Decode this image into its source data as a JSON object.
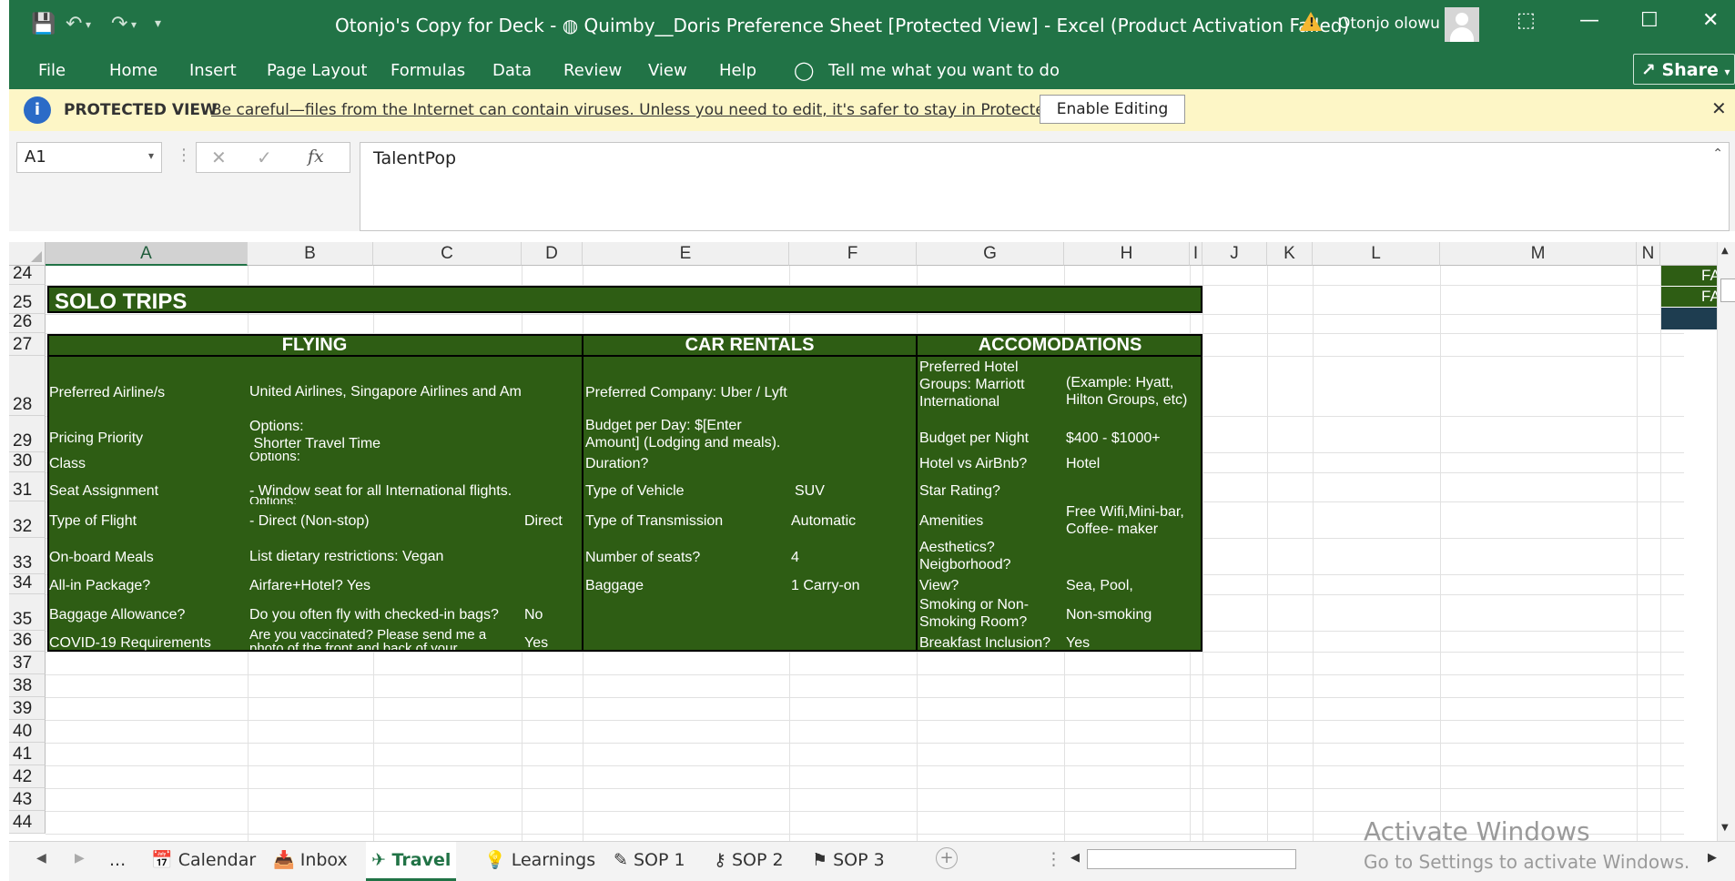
{
  "window": {
    "title": "Otonjo's Copy for Deck - ◍ Quimby__Doris Preference Sheet  [Protected View]  -  Excel (Product Activation Failed)",
    "user": "Otonjo olowu",
    "share_label": "Share"
  },
  "ribbon": {
    "tabs": [
      "File",
      "Home",
      "Insert",
      "Page Layout",
      "Formulas",
      "Data",
      "Review",
      "View",
      "Help"
    ],
    "tell_me": "Tell me what you want to do"
  },
  "protected_view": {
    "label": "PROTECTED VIEW",
    "message": "Be careful—files from the Internet can contain viruses. Unless you need to edit, it's safer to stay in Protected View.",
    "button": "Enable Editing"
  },
  "formula_bar": {
    "name_box": "A1",
    "fx": "fx",
    "formula": "TalentPop"
  },
  "columns": [
    "A",
    "B",
    "C",
    "D",
    "E",
    "F",
    "G",
    "H",
    "I",
    "J",
    "K",
    "L",
    "M",
    "N"
  ],
  "rows": [
    "24",
    "25",
    "26",
    "27",
    "28",
    "29",
    "30",
    "31",
    "32",
    "33",
    "34",
    "35",
    "36",
    "37",
    "38",
    "39",
    "40",
    "41",
    "42",
    "43",
    "44"
  ],
  "sheet": {
    "section_title": "SOLO TRIPS",
    "flying": {
      "header": "FLYING",
      "items": [
        {
          "label": "Preferred Airline/s",
          "value": "United Airlines, Singapore Airlines and Am",
          "extra": ""
        },
        {
          "label": "Pricing Priority",
          "value": "Options:\n Shorter Travel Time",
          "extra": ""
        },
        {
          "label": "Class",
          "value": "Options:",
          "extra": ""
        },
        {
          "label": "Seat Assignment",
          "value": "- Window seat for all International flights.",
          "extra": ""
        },
        {
          "label": "Type of Flight",
          "value": "- Direct (Non-stop)",
          "extra": "Direct"
        },
        {
          "label": "On-board Meals",
          "value": "List dietary restrictions: Vegan",
          "extra": ""
        },
        {
          "label": "All-in Package?",
          "value": "Airfare+Hotel? Yes",
          "extra": ""
        },
        {
          "label": "Baggage Allowance?",
          "value": "Do you often fly with checked-in bags?",
          "extra": "No"
        },
        {
          "label": "COVID-19 Requirements",
          "value": "Are you vaccinated? Please send me a photo of the front and back of your",
          "extra": "Yes"
        }
      ],
      "options_overflow": "Options:"
    },
    "car": {
      "header": "CAR RENTALS",
      "items": [
        {
          "label": "Preferred Company: Uber / Lyft",
          "value": ""
        },
        {
          "label": "Budget per Day: $[Enter Amount] (Lodging and meals).",
          "value": ""
        },
        {
          "label": "Duration?",
          "value": ""
        },
        {
          "label": "Type of Vehicle",
          "value": "SUV"
        },
        {
          "label": "Type of Transmission",
          "value": "Automatic"
        },
        {
          "label": "Number of seats?",
          "value": "4"
        },
        {
          "label": "Baggage",
          "value": "1 Carry-on"
        }
      ]
    },
    "accom": {
      "header": "ACCOMODATIONS",
      "items": [
        {
          "label": "Preferred Hotel Groups: Marriott International",
          "value": "(Example: Hyatt, Hilton Groups, etc)"
        },
        {
          "label": "Budget per Night",
          "value": "$400 - $1000+"
        },
        {
          "label": "Hotel vs AirBnb?",
          "value": "Hotel"
        },
        {
          "label": "Star Rating?",
          "value": ""
        },
        {
          "label": "Amenities",
          "value": "Free Wifi,Mini-bar, Coffee- maker"
        },
        {
          "label": "Aesthetics? Neigborhood?",
          "value": ""
        },
        {
          "label": "View?",
          "value": "Sea, Pool,"
        },
        {
          "label": "Smoking or Non-Smoking Room?",
          "value": "Non-smoking"
        },
        {
          "label": "Breakfast Inclusion?",
          "value": "Yes"
        }
      ]
    },
    "right_clip": [
      "FA",
      "FA"
    ]
  },
  "tabs": {
    "ellipsis": "...",
    "sheets": [
      "Calendar",
      "Inbox",
      "Travel",
      "Learnings",
      "SOP 1",
      "SOP 2",
      "SOP 3"
    ],
    "active": "Travel"
  },
  "watermark": {
    "line1": "Activate Windows",
    "line2": "Go to Settings to activate Windows."
  },
  "colors": {
    "excel_green": "#217346",
    "cell_green": "#2e5d14",
    "banner_yellow": "#fdf6c6"
  }
}
